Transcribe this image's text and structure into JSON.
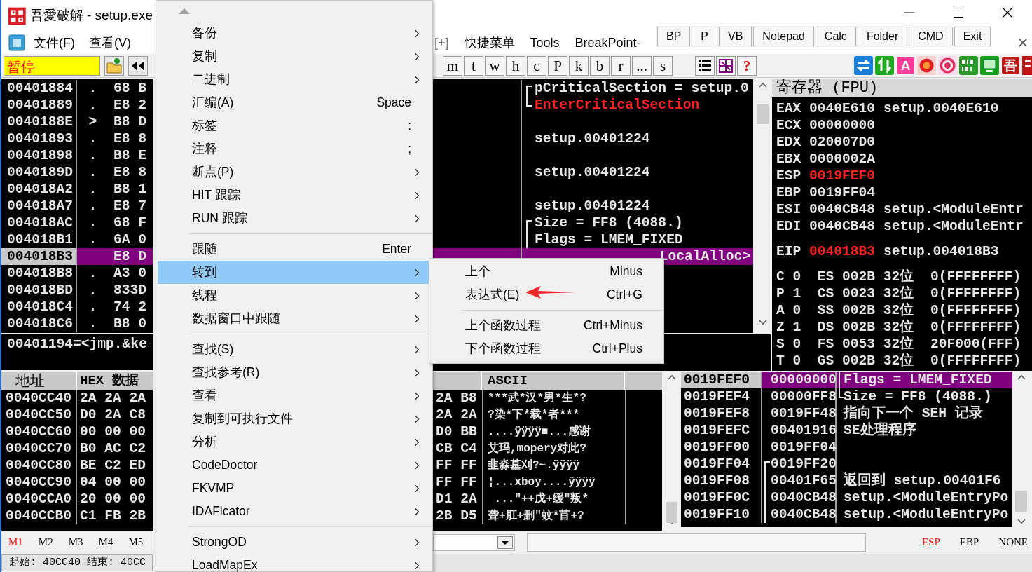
{
  "window": {
    "title": "吾愛破解 - setup.exe"
  },
  "menu_bar_start": [
    "文件(F)",
    "查看(V)"
  ],
  "menu_bar_end": [
    "[+]",
    "快捷菜单",
    "Tools",
    "BreakPoint-"
  ],
  "quick_buttons": [
    "BP",
    "P",
    "VB",
    "Notepad",
    "Calc",
    "Folder",
    "CMD",
    "Exit"
  ],
  "run_state": "暂停",
  "letter_buttons": [
    "m",
    "t",
    "w",
    "h",
    "c",
    "P",
    "k",
    "b",
    "r",
    "...",
    "s"
  ],
  "help_button": "?",
  "plugin_icons": [
    {
      "kind": "swap",
      "color": "#1a7fd8"
    },
    {
      "kind": "updown",
      "color": "#22aa22"
    },
    {
      "kind": "letter",
      "glyph": "A",
      "color": "#ff3c9a"
    },
    {
      "kind": "record",
      "color": "#e02020"
    },
    {
      "kind": "target",
      "color": "#e03060"
    },
    {
      "kind": "binary",
      "color": "#2a9a2a"
    },
    {
      "kind": "screen",
      "color": "#18a018"
    },
    {
      "kind": "letter",
      "glyph": "吾",
      "color": "#c01818"
    },
    {
      "kind": "tile",
      "color": "#c01818"
    }
  ],
  "disassembly": {
    "rows": [
      {
        "address": "00401884",
        "mark": ".",
        "hex": "68 B",
        "comment": "pCriticalSection = setup.0",
        "bracket_open": true,
        "selected": false
      },
      {
        "address": "00401889",
        "mark": ".",
        "hex": "E8 2",
        "comment": "EnterCriticalSection",
        "bracket_close": true,
        "kind": "api",
        "selected": false
      },
      {
        "address": "0040188E",
        "mark": ">",
        "hex": "B8 D",
        "selected": false
      },
      {
        "address": "00401893",
        "mark": ".",
        "hex": "E8 8",
        "comment": "setup.00401224",
        "selected": false
      },
      {
        "address": "00401898",
        "mark": ".",
        "hex": "B8 E",
        "selected": false
      },
      {
        "address": "0040189D",
        "mark": ".",
        "hex": "E8 8",
        "comment": "setup.00401224",
        "selected": false
      },
      {
        "address": "004018A2",
        "mark": ".",
        "hex": "B8 1",
        "selected": false
      },
      {
        "address": "004018A7",
        "mark": ".",
        "hex": "E8 7",
        "comment": "setup.00401224",
        "selected": false
      },
      {
        "address": "004018AC",
        "mark": ".",
        "hex": "68 F",
        "comment": "Size = FF8 (4088.)",
        "bracket_open": true,
        "selected": false
      },
      {
        "address": "004018B1",
        "mark": ".",
        "hex": "6A 0",
        "comment": "Flags = LMEM_FIXED",
        "bracket_through": true,
        "selected": false
      },
      {
        "address": "004018B3",
        "hex": "E8 D",
        "comment": "LocalAlloc>",
        "cut_start": true,
        "selected": true
      },
      {
        "address": "004018B8",
        "mark": ".",
        "hex": "A3 0",
        "selected": false
      },
      {
        "address": "004018BD",
        "mark": ".",
        "hex": "833D",
        "selected": false
      },
      {
        "address": "004018C4",
        "mark": ".",
        "hex": "74 2",
        "selected": false
      },
      {
        "address": "004018C6",
        "mark": ".",
        "hex": "B8 0",
        "selected": false
      }
    ]
  },
  "info_line": "00401194=<jmp.&ke",
  "registers": {
    "title": "寄存器 (FPU)",
    "general": [
      {
        "name": "EAX",
        "value": "0040E610",
        "comment": "setup.0040E610",
        "changed": false
      },
      {
        "name": "ECX",
        "value": "00000000",
        "changed": false
      },
      {
        "name": "EDX",
        "value": "020007D0",
        "changed": false
      },
      {
        "name": "EBX",
        "value": "0000002A",
        "changed": false
      },
      {
        "name": "ESP",
        "value": "0019FEF0",
        "changed": true
      },
      {
        "name": "EBP",
        "value": "0019FF04",
        "changed": false
      },
      {
        "name": "ESI",
        "value": "0040CB48",
        "comment": "setup.<ModuleEntr",
        "changed": false
      },
      {
        "name": "EDI",
        "value": "0040CB48",
        "comment": "setup.<ModuleEntr",
        "changed": false
      }
    ],
    "eip": {
      "name": "EIP",
      "value": "004018B3",
      "comment": "setup.004018B3",
      "changed": true
    },
    "flags": [
      "C 0  ES 002B 32位  0(FFFFFFFF)",
      "P 1  CS 0023 32位  0(FFFFFFFF)",
      "A 0  SS 002B 32位  0(FFFFFFFF)",
      "Z 1  DS 002B 32位  0(FFFFFFFF)",
      "S 0  FS 0053 32位  20F000(FFF)",
      "T 0  GS 002B 32位  0(FFFFFFFF)"
    ]
  },
  "dump": {
    "columns": [
      "地址",
      "HEX 数据",
      "ASCII"
    ],
    "rows": [
      {
        "address": "0040CC40",
        "hex_start": "2A 2A 2A",
        "hex_end": "2A B8",
        "ascii": "***武*汉*男*生*?"
      },
      {
        "address": "0040CC50",
        "hex_start": "D0 2A C8",
        "hex_end": "2A 2A",
        "ascii": "?染*下*载*者***"
      },
      {
        "address": "0040CC60",
        "hex_start": "00 00 00",
        "hex_end": "D0 BB",
        "ascii": "....ÿÿÿÿ■...感谢"
      },
      {
        "address": "0040CC70",
        "hex_start": "B0 AC C2",
        "hex_end": "CB C4",
        "ascii": "艾玛,mopery对此?"
      },
      {
        "address": "0040CC80",
        "hex_start": "BE C2 ED",
        "hex_end": "FF FF",
        "ascii": "韭淼墓刈?~.ÿÿÿÿ"
      },
      {
        "address": "0040CC90",
        "hex_start": "04 00 00",
        "hex_end": "FF FF",
        "ascii": "¦...xboy....ÿÿÿÿ"
      },
      {
        "address": "0040CCA0",
        "hex_start": "20 00 00",
        "hex_end": "D1 2A",
        "ascii": " ...\"++戊+缓\"叛*"
      },
      {
        "address": "0040CCB0",
        "hex_start": "C1 FB 2B",
        "hex_end": "2B D5",
        "ascii": "聋+肛+删\"蚊*苜+?"
      }
    ]
  },
  "stack": {
    "rows": [
      {
        "address": "0019FEF0",
        "value": "00000000",
        "comment": "Flags = LMEM_FIXED",
        "bracket_through": true,
        "selected": true
      },
      {
        "address": "0019FEF4",
        "value": "00000FF8",
        "comment": "Size = FF8 (4088.)",
        "bracket_close": true,
        "selected": false
      },
      {
        "address": "0019FEF8",
        "value": "0019FF48",
        "comment": "指向下一个 SEH 记录",
        "selected": false
      },
      {
        "address": "0019FEFC",
        "value": "00401916",
        "comment": "SE处理程序",
        "selected": false
      },
      {
        "address": "0019FF00",
        "value": "0019FF04",
        "selected": false
      },
      {
        "address": "0019FF04",
        "value": "0019FF20",
        "value_bracket_open": true,
        "selected": false
      },
      {
        "address": "0019FF08",
        "value": "00401F65",
        "value_bracket_through": true,
        "comment": "返回到 setup.00401F6",
        "selected": false
      },
      {
        "address": "0019FF0C",
        "value": "0040CB48",
        "value_bracket_through": true,
        "comment": "setup.<ModuleEntryPo",
        "selected": false
      },
      {
        "address": "0019FF10",
        "value": "0040CB48",
        "value_bracket_through": true,
        "comment": "setup.<ModuleEntryPo",
        "selected": false
      }
    ]
  },
  "memory_tabs": [
    {
      "label": "M1",
      "selected": true
    },
    {
      "label": "M2",
      "selected": false
    },
    {
      "label": "M3",
      "selected": false
    },
    {
      "label": "M4",
      "selected": false
    },
    {
      "label": "M5",
      "selected": false
    }
  ],
  "stack_modes": [
    {
      "label": "ESP",
      "selected": true
    },
    {
      "label": "EBP",
      "selected": false
    },
    {
      "label": "NONE",
      "selected": false
    }
  ],
  "status_bar": "起始: 40CC40 结束: 40CC",
  "context_menu": {
    "items": [
      {
        "kind": "item",
        "label": "备份",
        "submenu": true,
        "selected": false
      },
      {
        "kind": "item",
        "label": "复制",
        "submenu": true,
        "selected": false
      },
      {
        "kind": "item",
        "label": "二进制",
        "submenu": true,
        "selected": false
      },
      {
        "kind": "item",
        "label": "汇编(A)",
        "shortcut": "Space",
        "submenu": false,
        "selected": false
      },
      {
        "kind": "item",
        "label": "标签",
        "shortcut": ":",
        "submenu": false,
        "selected": false
      },
      {
        "kind": "item",
        "label": "注释",
        "shortcut": ";",
        "submenu": false,
        "selected": false
      },
      {
        "kind": "item",
        "label": "断点(P)",
        "submenu": true,
        "selected": false
      },
      {
        "kind": "item",
        "label": "HIT 跟踪",
        "submenu": true,
        "selected": false
      },
      {
        "kind": "item",
        "label": "RUN 跟踪",
        "submenu": true,
        "selected": false
      },
      {
        "kind": "separator"
      },
      {
        "kind": "item",
        "label": "跟随",
        "shortcut": "Enter",
        "submenu": false,
        "selected": false
      },
      {
        "kind": "item",
        "label": "转到",
        "submenu": true,
        "selected": true
      },
      {
        "kind": "item",
        "label": "线程",
        "submenu": true,
        "selected": false
      },
      {
        "kind": "item",
        "label": "数据窗口中跟随",
        "submenu": true,
        "selected": false
      },
      {
        "kind": "separator"
      },
      {
        "kind": "item",
        "label": "查找(S)",
        "submenu": true,
        "selected": false
      },
      {
        "kind": "item",
        "label": "查找参考(R)",
        "submenu": true,
        "selected": false
      },
      {
        "kind": "item",
        "label": "查看",
        "submenu": true,
        "selected": false
      },
      {
        "kind": "item",
        "label": "复制到可执行文件",
        "submenu": true,
        "selected": false
      },
      {
        "kind": "item",
        "label": "分析",
        "submenu": true,
        "selected": false
      },
      {
        "kind": "item",
        "label": "CodeDoctor",
        "submenu": true,
        "selected": false
      },
      {
        "kind": "item",
        "label": "FKVMP",
        "submenu": true,
        "selected": false
      },
      {
        "kind": "item",
        "label": "IDAFicator",
        "submenu": true,
        "selected": false
      },
      {
        "kind": "separator"
      },
      {
        "kind": "item",
        "label": "StrongOD",
        "submenu": true,
        "selected": false
      },
      {
        "kind": "item",
        "label": "LoadMapEx",
        "submenu": true,
        "selected": false
      }
    ]
  },
  "goto_submenu": {
    "items": [
      {
        "kind": "item",
        "label": "上个",
        "shortcut": "Minus"
      },
      {
        "kind": "item",
        "label": "表达式(E)",
        "shortcut": "Ctrl+G"
      },
      {
        "kind": "separator"
      },
      {
        "kind": "item",
        "label": "上个函数过程",
        "shortcut": "Ctrl+Minus"
      },
      {
        "kind": "item",
        "label": "下个函数过程",
        "shortcut": "Ctrl+Plus"
      }
    ]
  }
}
